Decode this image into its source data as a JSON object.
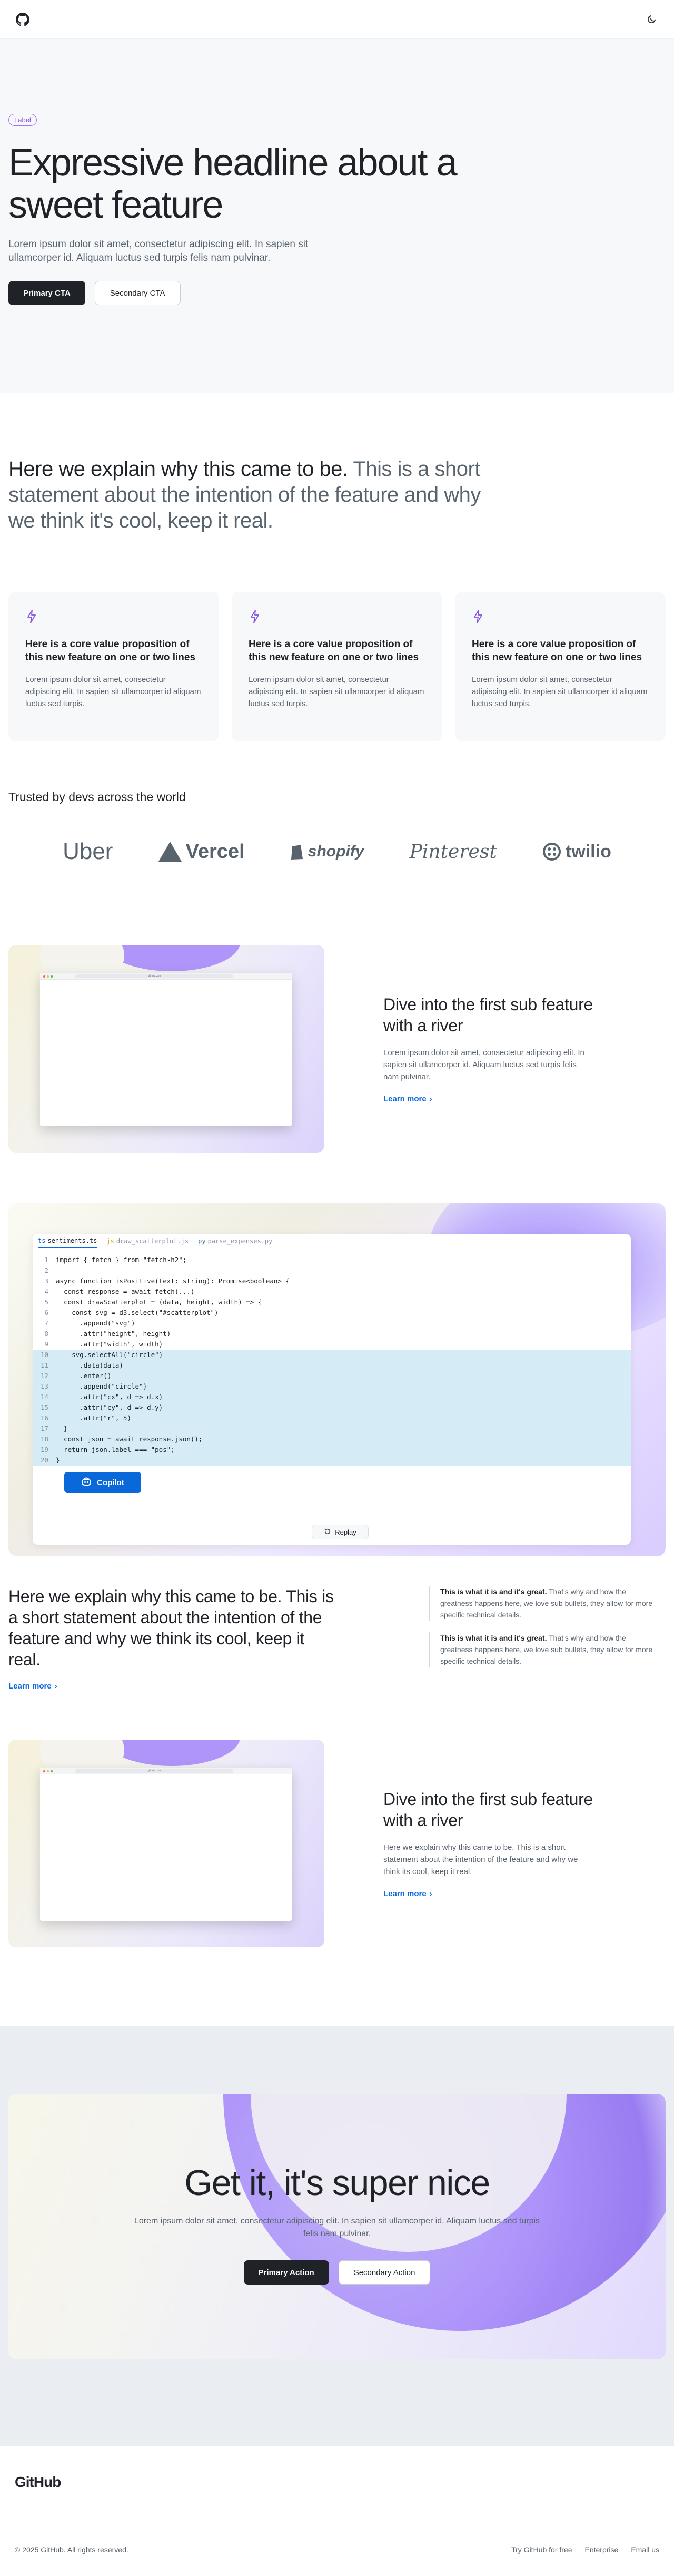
{
  "header": {
    "logo_icon": "github-mark-icon",
    "theme_icon": "moon-icon"
  },
  "hero": {
    "label": "Label",
    "headline": "Expressive headline about a sweet feature",
    "body": "Lorem ipsum dolor sit amet, consectetur adipiscing elit. In sapien sit ullamcorper id. Aliquam luctus sed turpis felis nam pulvinar.",
    "primary_cta": "Primary CTA",
    "secondary_cta": "Secondary CTA"
  },
  "statement": {
    "lead": "Here we explain why this came to be.",
    "muted": " This is a short statement about the intention of the feature and why we think it's cool, keep it real."
  },
  "cards": [
    {
      "icon": "sparkle-icon",
      "title": "Here is a core value proposition of this new feature on one or two lines",
      "body": "Lorem ipsum dolor sit amet, consectetur adipiscing elit. In sapien sit ullamcorper id aliquam luctus sed turpis."
    },
    {
      "icon": "sparkle-icon",
      "title": "Here is a core value proposition of this new feature on one or two lines",
      "body": "Lorem ipsum dolor sit amet, consectetur adipiscing elit. In sapien sit ullamcorper id aliquam luctus sed turpis."
    },
    {
      "icon": "sparkle-icon",
      "title": "Here is a core value proposition of this new feature on one or two lines",
      "body": "Lorem ipsum dolor sit amet, consectetur adipiscing elit. In sapien sit ullamcorper id aliquam luctus sed turpis."
    }
  ],
  "trusted": {
    "title": "Trusted by devs across the world",
    "logos": [
      "Uber",
      "Vercel",
      "shopify",
      "Pinterest",
      "twilio"
    ]
  },
  "river1": {
    "title": "Dive into the first sub feature with a river",
    "body": "Lorem ipsum dolor sit amet, consectetur adipiscing elit. In sapien sit ullamcorper id. Aliquam luctus sed turpis felis nam pulvinar.",
    "link": "Learn more",
    "url": "github.com"
  },
  "code": {
    "tabs": [
      "sentiments.ts",
      "draw_scatterplot.js",
      "parse_expenses.py"
    ],
    "lines": [
      "import { fetch } from \"fetch-h2\";",
      "",
      "async function isPositive(text: string): Promise<boolean> {",
      "  const response = await fetch(...)",
      "  const drawScatterplot = (data, height, width) => {",
      "    const svg = d3.select(\"#scatterplot\")",
      "      .append(\"svg\")",
      "      .attr(\"height\", height)",
      "      .attr(\"width\", width)",
      "    svg.selectAll(\"circle\")",
      "      .data(data)",
      "      .enter()",
      "      .append(\"circle\")",
      "      .attr(\"cx\", d => d.x)",
      "      .attr(\"cy\", d => d.y)",
      "      .attr(\"r\", 5)",
      "  }",
      "  const json = await response.json();",
      "  return json.label === \"pos\";",
      "}"
    ],
    "highlight_from": 10,
    "highlight_to": 20,
    "copilot_label": "Copilot",
    "replay_label": "Replay"
  },
  "explain": {
    "heading": "Here we explain why this came to be. This is a short statement about the intention of the feature and why we think its cool, keep it real.",
    "link": "Learn more",
    "bullets": [
      {
        "bold": "This is what it is and it's great.",
        "rest": " That's why and how the greatness happens here, we love sub bullets, they allow for more specific technical details."
      },
      {
        "bold": "This is what it is and it's great.",
        "rest": " That's why and how the greatness happens here, we love sub bullets, they allow for more specific technical details."
      }
    ]
  },
  "river2": {
    "title": "Dive into the first sub feature with a river",
    "body": "Here we explain why this came to be. This is a short statement about the intention of the feature and why we think its cool, keep it real.",
    "link": "Learn more",
    "url": "github.com"
  },
  "cta": {
    "title": "Get it, it's super nice",
    "body": "Lorem ipsum dolor sit amet, consectetur adipiscing elit. In sapien sit ullamcorper id. Aliquam luctus sed turpis felis nam pulvinar.",
    "primary": "Primary Action",
    "secondary": "Secondary Action"
  },
  "footer": {
    "brand": "GitHub",
    "copyright": "© 2025 GitHub. All rights reserved.",
    "links": [
      "Try GitHub for free",
      "Enterprise",
      "Email us"
    ]
  },
  "colors": {
    "accent": "#0969da",
    "purple": "#8250df",
    "dark": "#1f2328"
  }
}
